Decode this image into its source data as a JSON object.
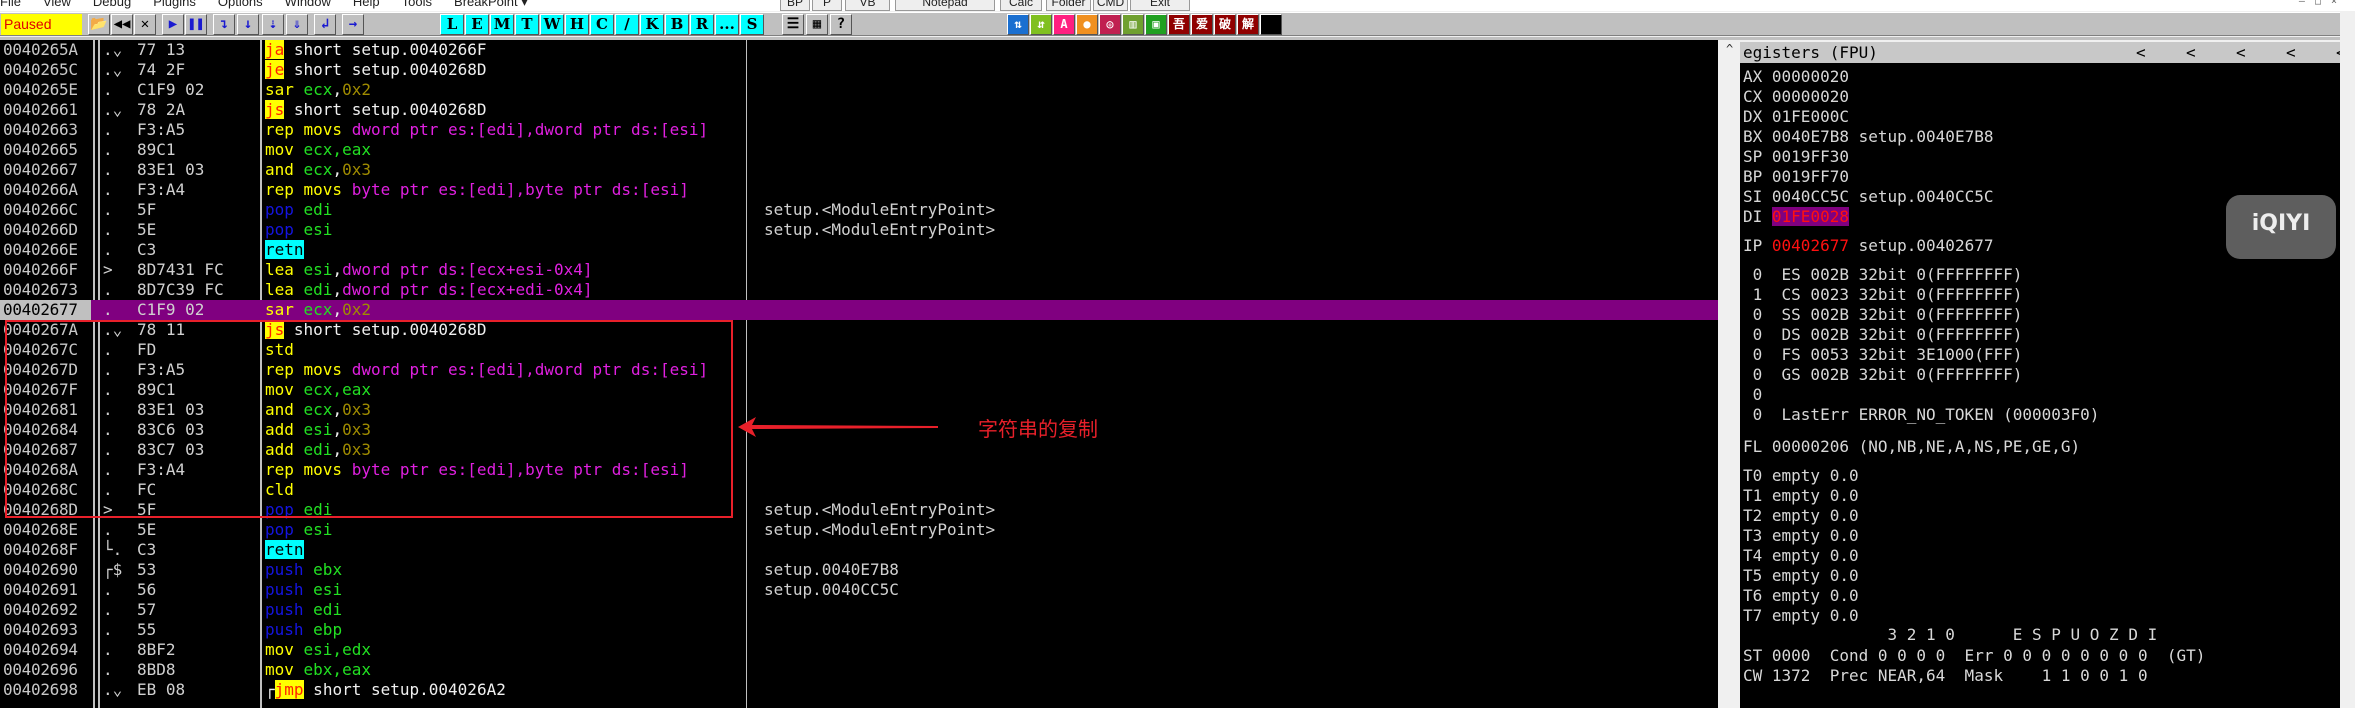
{
  "menu": [
    "File",
    "View",
    "Debug",
    "Plugins",
    "Options",
    "Window",
    "Help",
    "Tools",
    "BreakPoint ▾"
  ],
  "top_tabs": [
    "BP",
    "P",
    "VB",
    "Notepad",
    "Calc",
    "Folder",
    "CMD",
    "Exit"
  ],
  "window_controls": [
    "–",
    "□",
    "×"
  ],
  "toolbar": {
    "status": "Paused",
    "buttons": [
      {
        "name": "open-icon",
        "glyph": "📂"
      },
      {
        "name": "restart-icon",
        "glyph": "◀◀"
      },
      {
        "name": "close-icon",
        "glyph": "✕"
      },
      {
        "name": "run-icon",
        "glyph": "▶"
      },
      {
        "name": "pause-icon",
        "glyph": "❚❚"
      },
      {
        "name": "step-into-icon",
        "glyph": "↴"
      },
      {
        "name": "step-over-icon",
        "glyph": "↓"
      },
      {
        "name": "trace-into-icon",
        "glyph": "⇣"
      },
      {
        "name": "trace-over-icon",
        "glyph": "⇓"
      },
      {
        "name": "execute-till-return-icon",
        "glyph": "↲"
      },
      {
        "name": "goto-icon",
        "glyph": "→"
      }
    ],
    "letters": [
      "L",
      "E",
      "M",
      "T",
      "W",
      "H",
      "C",
      "/",
      "K",
      "B",
      "R",
      "...",
      "S"
    ],
    "misc": [
      {
        "name": "list-icon",
        "glyph": "☰"
      },
      {
        "name": "colors-icon",
        "glyph": "▦"
      },
      {
        "name": "help-icon",
        "glyph": "?"
      }
    ],
    "plugins": [
      {
        "name": "swap-icon",
        "glyph": "⇅",
        "color": "#1a6fd0"
      },
      {
        "name": "green-arrows-icon",
        "glyph": "⇵",
        "color": "#80c020"
      },
      {
        "name": "a-icon",
        "glyph": "A",
        "color": "#ff2080"
      },
      {
        "name": "record-icon",
        "glyph": "●",
        "color": "#f09020"
      },
      {
        "name": "target-icon",
        "glyph": "◎",
        "color": "#c02050"
      },
      {
        "name": "grid-icon",
        "glyph": "▥",
        "color": "#70a030"
      },
      {
        "name": "window-icon",
        "glyph": "▣",
        "color": "#20a020"
      },
      {
        "name": "wu-icon",
        "glyph": "吾",
        "color": "#900000"
      },
      {
        "name": "ai-icon",
        "glyph": "爱",
        "color": "#900000"
      },
      {
        "name": "po-icon",
        "glyph": "破",
        "color": "#900000"
      },
      {
        "name": "jie-icon",
        "glyph": "解",
        "color": "#900000"
      },
      {
        "name": "black-icon",
        "glyph": "",
        "color": "#000000"
      }
    ]
  },
  "disasm": [
    {
      "addr": "0040265A",
      "mark": ".⌄",
      "hex": "77 13",
      "dis": [
        [
          "ja",
          "jmp"
        ],
        [
          " short setup.0040266F",
          "txt"
        ]
      ],
      "cmt": ""
    },
    {
      "addr": "0040265C",
      "mark": ".⌄",
      "hex": "74 2F",
      "dis": [
        [
          "je",
          "jmp"
        ],
        [
          " short setup.0040268D",
          "txt"
        ]
      ],
      "cmt": ""
    },
    {
      "addr": "0040265E",
      "mark": ".",
      "hex": "C1F9 02",
      "dis": [
        [
          "sar ",
          "mn"
        ],
        [
          "ecx",
          "reg"
        ],
        [
          ",",
          "txt"
        ],
        [
          "0x2",
          "imm"
        ]
      ],
      "cmt": ""
    },
    {
      "addr": "00402661",
      "mark": ".⌄",
      "hex": "78 2A",
      "dis": [
        [
          "js",
          "jmp"
        ],
        [
          " short setup.0040268D",
          "txt"
        ]
      ],
      "cmt": ""
    },
    {
      "addr": "00402663",
      "mark": ".",
      "hex": "F3:A5",
      "dis": [
        [
          "rep movs ",
          "mn"
        ],
        [
          "dword ptr es:[edi],dword ptr ds:[esi]",
          "mem"
        ]
      ],
      "cmt": ""
    },
    {
      "addr": "00402665",
      "mark": ".",
      "hex": "89C1",
      "dis": [
        [
          "mov ",
          "mn"
        ],
        [
          "ecx,eax",
          "reg"
        ]
      ],
      "cmt": ""
    },
    {
      "addr": "00402667",
      "mark": ".",
      "hex": "83E1 03",
      "dis": [
        [
          "and ",
          "mn"
        ],
        [
          "ecx",
          "reg"
        ],
        [
          ",",
          "txt"
        ],
        [
          "0x3",
          "imm"
        ]
      ],
      "cmt": ""
    },
    {
      "addr": "0040266A",
      "mark": ".",
      "hex": "F3:A4",
      "dis": [
        [
          "rep movs ",
          "mn"
        ],
        [
          "byte ptr es:[edi],byte ptr ds:[esi]",
          "mem"
        ]
      ],
      "cmt": ""
    },
    {
      "addr": "0040266C",
      "mark": ".",
      "hex": "5F",
      "dis": [
        [
          "pop ",
          "stk"
        ],
        [
          "edi",
          "reg"
        ]
      ],
      "cmt": "setup.<ModuleEntryPoint>"
    },
    {
      "addr": "0040266D",
      "mark": ".",
      "hex": "5E",
      "dis": [
        [
          "pop ",
          "stk"
        ],
        [
          "esi",
          "reg"
        ]
      ],
      "cmt": "setup.<ModuleEntryPoint>"
    },
    {
      "addr": "0040266E",
      "mark": ".",
      "hex": "C3",
      "dis": [
        [
          "retn",
          "ret"
        ]
      ],
      "cmt": ""
    },
    {
      "addr": "0040266F",
      "mark": ">",
      "hex": "8D7431 FC",
      "dis": [
        [
          "lea ",
          "mn"
        ],
        [
          "esi",
          "reg"
        ],
        [
          ",",
          "txt"
        ],
        [
          "dword ptr ds:[ecx+esi-0x4]",
          "mem"
        ]
      ],
      "cmt": ""
    },
    {
      "addr": "00402673",
      "mark": ".",
      "hex": "8D7C39 FC",
      "dis": [
        [
          "lea ",
          "mn"
        ],
        [
          "edi",
          "reg"
        ],
        [
          ",",
          "txt"
        ],
        [
          "dword ptr ds:[ecx+edi-0x4]",
          "mem"
        ]
      ],
      "cmt": ""
    },
    {
      "addr": "00402677",
      "mark": ".",
      "hex": "C1F9 02",
      "dis": [
        [
          "sar ",
          "mn"
        ],
        [
          "ecx",
          "reg"
        ],
        [
          ",",
          "txt"
        ],
        [
          "0x2",
          "imm"
        ]
      ],
      "cmt": "",
      "selected": true
    },
    {
      "addr": "0040267A",
      "mark": ".⌄",
      "hex": "78 11",
      "dis": [
        [
          "js",
          "jmp"
        ],
        [
          " short setup.0040268D",
          "txt"
        ]
      ],
      "cmt": ""
    },
    {
      "addr": "0040267C",
      "mark": ".",
      "hex": "FD",
      "dis": [
        [
          "std",
          "mn"
        ]
      ],
      "cmt": ""
    },
    {
      "addr": "0040267D",
      "mark": ".",
      "hex": "F3:A5",
      "dis": [
        [
          "rep movs ",
          "mn"
        ],
        [
          "dword ptr es:[edi],dword ptr ds:[esi]",
          "mem"
        ]
      ],
      "cmt": ""
    },
    {
      "addr": "0040267F",
      "mark": ".",
      "hex": "89C1",
      "dis": [
        [
          "mov ",
          "mn"
        ],
        [
          "ecx,eax",
          "reg"
        ]
      ],
      "cmt": ""
    },
    {
      "addr": "00402681",
      "mark": ".",
      "hex": "83E1 03",
      "dis": [
        [
          "and ",
          "mn"
        ],
        [
          "ecx",
          "reg"
        ],
        [
          ",",
          "txt"
        ],
        [
          "0x3",
          "imm"
        ]
      ],
      "cmt": ""
    },
    {
      "addr": "00402684",
      "mark": ".",
      "hex": "83C6 03",
      "dis": [
        [
          "add ",
          "mn"
        ],
        [
          "esi",
          "reg"
        ],
        [
          ",",
          "txt"
        ],
        [
          "0x3",
          "imm"
        ]
      ],
      "cmt": ""
    },
    {
      "addr": "00402687",
      "mark": ".",
      "hex": "83C7 03",
      "dis": [
        [
          "add ",
          "mn"
        ],
        [
          "edi",
          "reg"
        ],
        [
          ",",
          "txt"
        ],
        [
          "0x3",
          "imm"
        ]
      ],
      "cmt": ""
    },
    {
      "addr": "0040268A",
      "mark": ".",
      "hex": "F3:A4",
      "dis": [
        [
          "rep movs ",
          "mn"
        ],
        [
          "byte ptr es:[edi],byte ptr ds:[esi]",
          "mem"
        ]
      ],
      "cmt": ""
    },
    {
      "addr": "0040268C",
      "mark": ".",
      "hex": "FC",
      "dis": [
        [
          "cld",
          "mn"
        ]
      ],
      "cmt": ""
    },
    {
      "addr": "0040268D",
      "mark": ">",
      "hex": "5F",
      "dis": [
        [
          "pop ",
          "stk"
        ],
        [
          "edi",
          "reg"
        ]
      ],
      "cmt": "setup.<ModuleEntryPoint>"
    },
    {
      "addr": "0040268E",
      "mark": ".",
      "hex": "5E",
      "dis": [
        [
          "pop ",
          "stk"
        ],
        [
          "esi",
          "reg"
        ]
      ],
      "cmt": "setup.<ModuleEntryPoint>"
    },
    {
      "addr": "0040268F",
      "mark": "└.",
      "hex": "C3",
      "dis": [
        [
          "retn",
          "ret"
        ]
      ],
      "cmt": ""
    },
    {
      "addr": "00402690",
      "mark": "┌$",
      "hex": "53",
      "dis": [
        [
          "push ",
          "stk"
        ],
        [
          "ebx",
          "reg"
        ]
      ],
      "cmt": "setup.0040E7B8"
    },
    {
      "addr": "00402691",
      "mark": ".",
      "hex": "56",
      "dis": [
        [
          "push ",
          "stk"
        ],
        [
          "esi",
          "reg"
        ]
      ],
      "cmt": "setup.0040CC5C"
    },
    {
      "addr": "00402692",
      "mark": ".",
      "hex": "57",
      "dis": [
        [
          "push ",
          "stk"
        ],
        [
          "edi",
          "reg"
        ]
      ],
      "cmt": ""
    },
    {
      "addr": "00402693",
      "mark": ".",
      "hex": "55",
      "dis": [
        [
          "push ",
          "stk"
        ],
        [
          "ebp",
          "reg"
        ]
      ],
      "cmt": ""
    },
    {
      "addr": "00402694",
      "mark": ".",
      "hex": "8BF2",
      "dis": [
        [
          "mov ",
          "mn"
        ],
        [
          "esi,edx",
          "reg"
        ]
      ],
      "cmt": ""
    },
    {
      "addr": "00402696",
      "mark": ".",
      "hex": "8BD8",
      "dis": [
        [
          "mov ",
          "mn"
        ],
        [
          "ebx,eax",
          "reg"
        ]
      ],
      "cmt": ""
    },
    {
      "addr": "00402698",
      "mark": ".⌄",
      "hex": "EB 08",
      "dis": [
        [
          "┌",
          "txt"
        ],
        [
          "jmp",
          "jmp"
        ],
        [
          " short setup.004026A2",
          "txt"
        ]
      ],
      "cmt": ""
    }
  ],
  "annotation": {
    "text": "字符串的复制",
    "color": "#e8202a"
  },
  "registers": {
    "title": "egisters (FPU)",
    "chevrons": [
      "<",
      "<",
      "<",
      "<",
      "<"
    ],
    "gp": [
      {
        "name": "AX",
        "value": "00000020",
        "info": ""
      },
      {
        "name": "CX",
        "value": "00000020",
        "info": ""
      },
      {
        "name": "DX",
        "value": "01FE000C",
        "info": ""
      },
      {
        "name": "BX",
        "value": "0040E7B8",
        "info": "setup.0040E7B8"
      },
      {
        "name": "SP",
        "value": "0019FF30",
        "info": ""
      },
      {
        "name": "BP",
        "value": "0019FF70",
        "info": ""
      },
      {
        "name": "SI",
        "value": "0040CC5C",
        "info": "setup.0040CC5C"
      },
      {
        "name": "DI",
        "value": "01FE0028",
        "info": "",
        "changed": true
      }
    ],
    "ip": {
      "name": "IP",
      "value": "00402677",
      "info": "setup.00402677"
    },
    "segments": [
      " 0  ES 002B 32bit 0(FFFFFFFF)",
      " 1  CS 0023 32bit 0(FFFFFFFF)",
      " 0  SS 002B 32bit 0(FFFFFFFF)",
      " 0  DS 002B 32bit 0(FFFFFFFF)",
      " 0  FS 0053 32bit 3E1000(FFF)",
      " 0  GS 002B 32bit 0(FFFFFFFF)",
      " 0",
      " 0  LastErr ERROR_NO_TOKEN (000003F0)"
    ],
    "flags": "FL 00000206 (NO,NB,NE,A,NS,PE,GE,G)",
    "fpu": [
      "T0 empty 0.0",
      "T1 empty 0.0",
      "T2 empty 0.0",
      "T3 empty 0.0",
      "T4 empty 0.0",
      "T5 empty 0.0",
      "T6 empty 0.0",
      "T7 empty 0.0"
    ],
    "bits_header": "               3 2 1 0      E S P U O Z D I",
    "st": "ST 0000  Cond 0 0 0 0  Err 0 0 0 0 0 0 0 0  (GT)",
    "cw": "CW 1372  Prec NEAR,64  Mask    1 1 0 0 1 0"
  },
  "watermark": "iQIYI"
}
